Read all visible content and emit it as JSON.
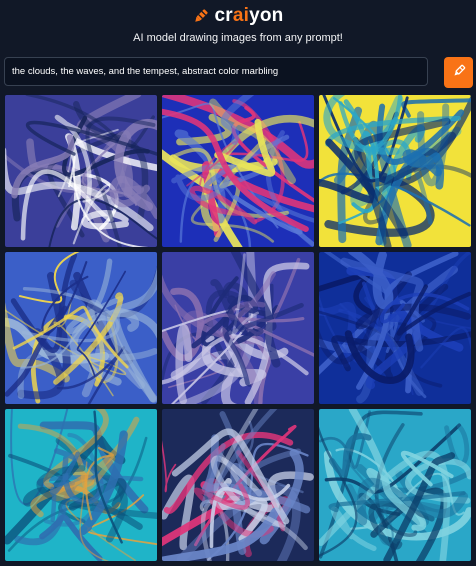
{
  "header": {
    "logo_prefix": "cr",
    "logo_accent": "ai",
    "logo_suffix": "yon",
    "tagline": "AI model drawing images from any prompt!"
  },
  "prompt": {
    "value": "the clouds, the waves, and the tempest, abstract color marbling"
  },
  "icons": {
    "logo": "crayon-icon",
    "draw_button": "crayon-icon"
  },
  "colors": {
    "accent": "#f97316",
    "background": "#111827"
  },
  "results": {
    "images": [
      {
        "name": "generated-image-1",
        "palette": [
          "#3b3f9a",
          "#8a7fb7",
          "#ffffff",
          "#16245a"
        ]
      },
      {
        "name": "generated-image-2",
        "palette": [
          "#1d2fb8",
          "#e9e45a",
          "#5a7ad8",
          "#e0357a"
        ]
      },
      {
        "name": "generated-image-3",
        "palette": [
          "#f2e23a",
          "#1c6fb0",
          "#2ba7c8",
          "#0b2e6f"
        ]
      },
      {
        "name": "generated-image-4",
        "palette": [
          "#3b5fc8",
          "#9ab5d9",
          "#1c2f8a",
          "#f2d74a"
        ]
      },
      {
        "name": "generated-image-5",
        "palette": [
          "#3a3fa5",
          "#c9c7e6",
          "#1f2c7a",
          "#8a6fb0"
        ]
      },
      {
        "name": "generated-image-6",
        "palette": [
          "#0f2f9a",
          "#1d3fb8",
          "#0a1c6a",
          "#3c5fc8"
        ]
      },
      {
        "name": "generated-image-7",
        "palette": [
          "#1fb4c8",
          "#2e6fb0",
          "#e9a23a",
          "#0b4f7a"
        ]
      },
      {
        "name": "generated-image-8",
        "palette": [
          "#1c2a5a",
          "#6a86c8",
          "#c8d2ea",
          "#e0357a"
        ]
      },
      {
        "name": "generated-image-9",
        "palette": [
          "#2aa7c8",
          "#1a6f9a",
          "#7fd2e0",
          "#0c3f6a"
        ]
      }
    ]
  }
}
